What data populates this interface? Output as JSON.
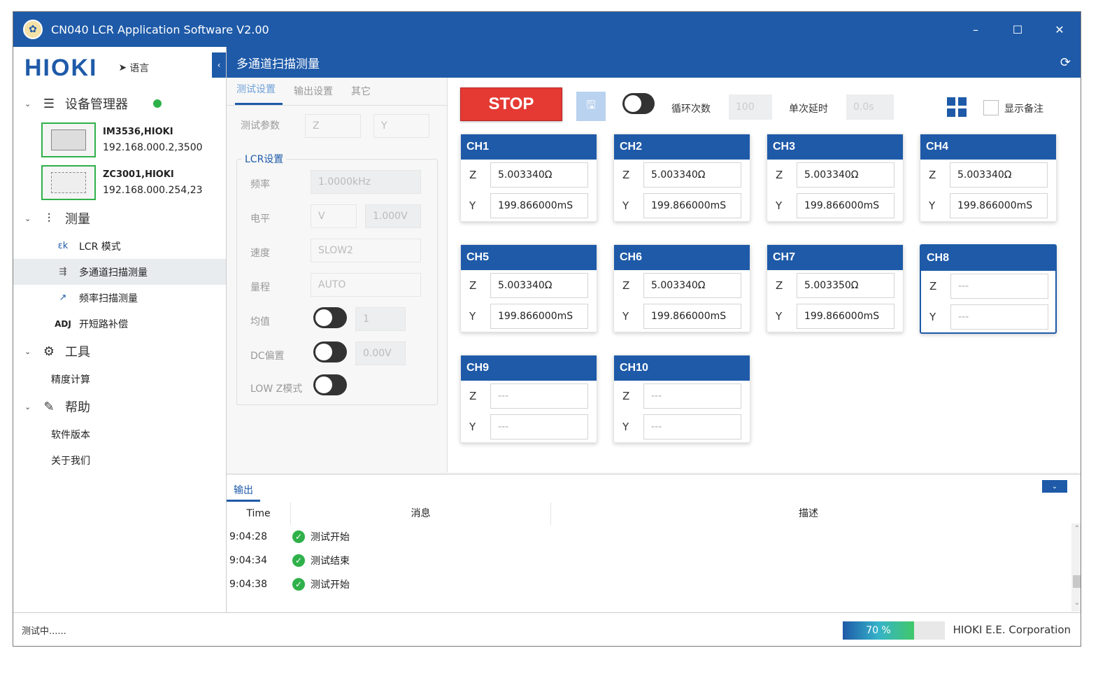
{
  "window": {
    "title": "CN040 LCR Application Software V2.00",
    "controls": {
      "minimize": "–",
      "maximize": "☐",
      "close": "✕"
    }
  },
  "sidebar": {
    "logo": "HIOKI",
    "language": "语言",
    "device_manager": {
      "label": "设备管理器",
      "status_color": "#2fb14a",
      "devices": [
        {
          "name": "IM3536,HIOKI",
          "address": "192.168.000.2,3500"
        },
        {
          "name": "ZC3001,HIOKI",
          "address": "192.168.000.254,23"
        }
      ]
    },
    "measure": {
      "label": "测量",
      "items": [
        {
          "icon": "εk",
          "label": "LCR 模式"
        },
        {
          "icon": "⇶",
          "label": "多通道扫描测量"
        },
        {
          "icon": "↗",
          "label": "频率扫描测量"
        },
        {
          "icon": "ADJ",
          "label": "开短路补偿"
        }
      ]
    },
    "tools": {
      "label": "工具",
      "items": [
        "精度计算"
      ]
    },
    "help": {
      "label": "帮助",
      "items": [
        "软件版本",
        "关于我们"
      ]
    }
  },
  "main": {
    "title": "多通道扫描测量",
    "settings": {
      "tabs": [
        "测试设置",
        "输出设置",
        "其它"
      ],
      "test_param_label": "测试参数",
      "test_param_1": "Z",
      "test_param_2": "Y",
      "lcr_legend": "LCR设置",
      "freq_label": "频率",
      "freq_value": "1.0000kHz",
      "level_label": "电平",
      "level_unit": "V",
      "level_value": "1.000V",
      "speed_label": "速度",
      "speed_value": "SLOW2",
      "range_label": "量程",
      "range_value": "AUTO",
      "avg_label": "均值",
      "avg_value": "1",
      "dc_label": "DC偏置",
      "dc_value": "0.00V",
      "lowz_label": "LOW Z模式"
    },
    "toolbar": {
      "stop": "STOP",
      "loop_label": "循环次数",
      "loop_value": "100",
      "delay_label": "单次延时",
      "delay_value": "0.0s",
      "show_note": "显示备注"
    },
    "channels": [
      {
        "name": "CH1",
        "z": "5.003340Ω",
        "y": "199.866000mS"
      },
      {
        "name": "CH2",
        "z": "5.003340Ω",
        "y": "199.866000mS"
      },
      {
        "name": "CH3",
        "z": "5.003340Ω",
        "y": "199.866000mS"
      },
      {
        "name": "CH4",
        "z": "5.003340Ω",
        "y": "199.866000mS"
      },
      {
        "name": "CH5",
        "z": "5.003340Ω",
        "y": "199.866000mS"
      },
      {
        "name": "CH6",
        "z": "5.003340Ω",
        "y": "199.866000mS"
      },
      {
        "name": "CH7",
        "z": "5.003350Ω",
        "y": "199.866000mS"
      },
      {
        "name": "CH8",
        "z": "---",
        "y": "---"
      },
      {
        "name": "CH9",
        "z": "---",
        "y": "---"
      },
      {
        "name": "CH10",
        "z": "---",
        "y": "---"
      }
    ],
    "param_keys": {
      "z": "Z",
      "y": "Y"
    }
  },
  "output": {
    "tab": "输出",
    "columns": [
      "Time",
      "消息",
      "描述"
    ],
    "rows": [
      {
        "time": "9:04:28",
        "message": "测试开始"
      },
      {
        "time": "9:04:34",
        "message": "测试结束"
      },
      {
        "time": "9:04:38",
        "message": "测试开始"
      }
    ]
  },
  "statusbar": {
    "status": "测试中......",
    "progress": 70,
    "progress_label": "70 %",
    "company": "HIOKI E.E. Corporation"
  }
}
